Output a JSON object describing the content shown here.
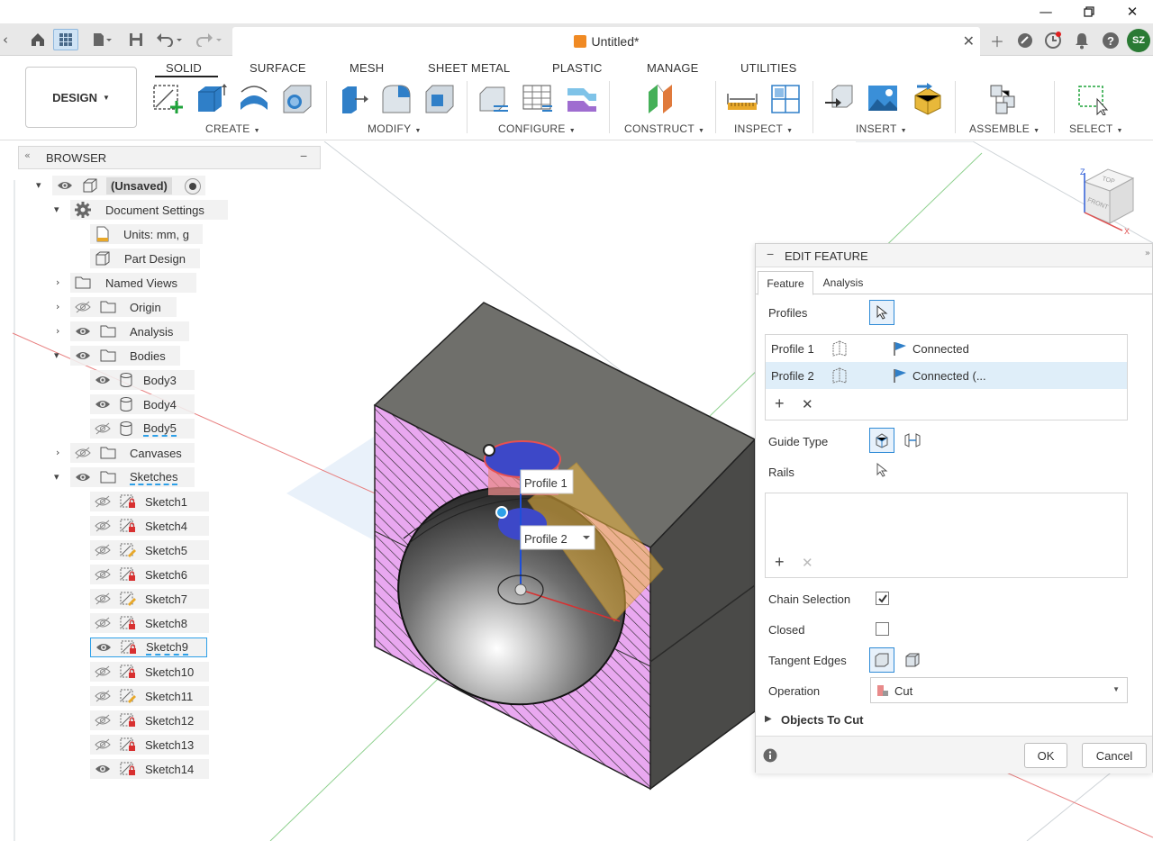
{
  "document": {
    "title": "Untitled*"
  },
  "user": {
    "initials": "SZ"
  },
  "workspace": {
    "label": "DESIGN"
  },
  "ribbon": {
    "tabs": [
      "SOLID",
      "SURFACE",
      "MESH",
      "SHEET METAL",
      "PLASTIC",
      "MANAGE",
      "UTILITIES"
    ],
    "groups": [
      "CREATE",
      "MODIFY",
      "CONFIGURE",
      "CONSTRUCT",
      "INSPECT",
      "INSERT",
      "ASSEMBLE",
      "SELECT"
    ]
  },
  "browser": {
    "title": "BROWSER",
    "root": "(Unsaved)",
    "document_settings": "Document Settings",
    "units": "Units: mm, g",
    "part_design": "Part Design",
    "named_views": "Named Views",
    "origin": "Origin",
    "analysis": "Analysis",
    "bodies": "Bodies",
    "body_items": [
      "Body3",
      "Body4",
      "Body5"
    ],
    "canvases": "Canvases",
    "sketches": "Sketches",
    "sketch_items": [
      "Sketch1",
      "Sketch4",
      "Sketch5",
      "Sketch6",
      "Sketch7",
      "Sketch8",
      "Sketch9",
      "Sketch10",
      "Sketch11",
      "Sketch12",
      "Sketch13",
      "Sketch14"
    ]
  },
  "viewport": {
    "profile1_label": "Profile 1",
    "profile2_label": "Profile 2",
    "viewcube_top": "TOP",
    "viewcube_front": "FRONT",
    "axis_z": "Z",
    "axis_x": "X"
  },
  "edit_feature": {
    "title": "EDIT FEATURE",
    "tabs": [
      "Feature",
      "Analysis"
    ],
    "profiles_label": "Profiles",
    "profile_rows": [
      {
        "name": "Profile 1",
        "status": "Connected"
      },
      {
        "name": "Profile 2",
        "status": "Connected (..."
      }
    ],
    "guide_type_label": "Guide Type",
    "rails_label": "Rails",
    "chain_selection_label": "Chain Selection",
    "chain_selection_checked": true,
    "closed_label": "Closed",
    "closed_checked": false,
    "tangent_edges_label": "Tangent Edges",
    "operation_label": "Operation",
    "operation_value": "Cut",
    "objects_to_cut_label": "Objects To Cut",
    "ok_label": "OK",
    "cancel_label": "Cancel"
  },
  "colors": {
    "accent": "#0696d7",
    "section_fill": "#e9a8f0",
    "avatar": "#2a7a34"
  }
}
